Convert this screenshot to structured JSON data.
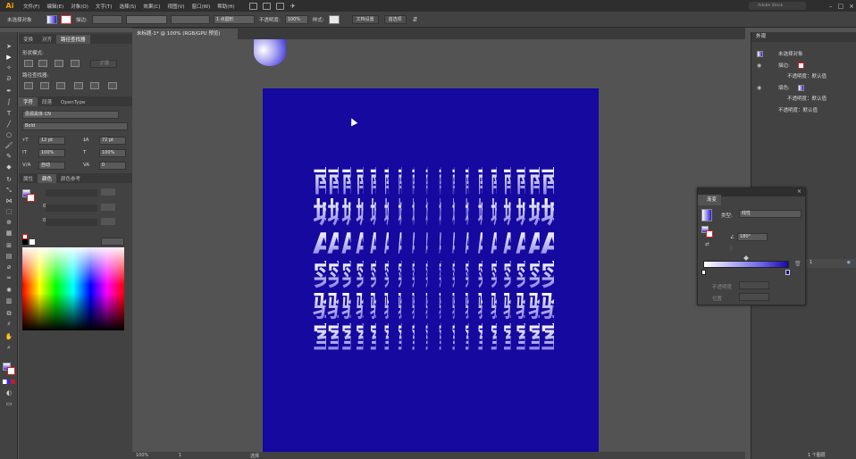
{
  "menubar": {
    "logo": "Ai",
    "items": [
      "文件(F)",
      "编辑(E)",
      "对象(O)",
      "文字(T)",
      "选择(S)",
      "效果(C)",
      "视图(V)",
      "窗口(W)",
      "帮助(H)"
    ],
    "search_label": "Adobe Stock"
  },
  "controlbar": {
    "selection_state": "未选择对象",
    "stroke_label": "描边:",
    "stroke_weight_label": "1 点圆形",
    "opacity_label": "不透明度:",
    "opacity_value": "100%",
    "style_label": "样式:",
    "doc_setup_button": "文档设置",
    "preferences_button": "首选项"
  },
  "left_panel": {
    "top_tabs": [
      "变换",
      "对齐",
      "路径查找器"
    ],
    "shape_modes_label": "形状模式:",
    "expand_button": "扩展",
    "pathfinders_label": "路径查找器:",
    "char_tabs": [
      "字符",
      "段落",
      "OpenType"
    ],
    "font_family": "思源黑体 CN",
    "font_style": "Bold",
    "font_size": "12 pt",
    "leading": "72 pt",
    "vscale": "100%",
    "hscale": "100%",
    "kerning": "自动",
    "tracking": "0",
    "color_tabs": [
      "属性",
      "颜色",
      "颜色参考"
    ],
    "field_zero_1": "0",
    "field_zero_2": "0"
  },
  "document": {
    "tab_title": "未标题-1* @ 100% (RGB/GPU 预览)",
    "artwork_rows": [
      [
        "南",
        "南",
        "南",
        "南",
        "南",
        "南",
        "南",
        "南",
        "南",
        "南",
        "南",
        "南",
        "南",
        "南",
        "南",
        "南",
        "南",
        "南"
      ],
      [
        "城",
        "城",
        "城",
        "城",
        "城",
        "城",
        "城",
        "城",
        "城",
        "城",
        "城",
        "城",
        "城",
        "城",
        "城",
        "城",
        "城",
        "城"
      ],
      [
        "A",
        "A",
        "A",
        "A",
        "A",
        "A",
        "A",
        "A",
        "A",
        "A",
        "A",
        "A",
        "A",
        "A",
        "A",
        "A",
        "A",
        "A"
      ],
      [
        "实",
        "实",
        "实",
        "实",
        "实",
        "实",
        "实",
        "实",
        "实",
        "实",
        "实",
        "实",
        "实",
        "实",
        "实",
        "实",
        "实",
        "实"
      ],
      [
        "验",
        "验",
        "验",
        "验",
        "验",
        "验",
        "验",
        "验",
        "验",
        "验",
        "验",
        "验",
        "验",
        "验",
        "验",
        "验",
        "验",
        "验"
      ],
      [
        "室",
        "室",
        "室",
        "室",
        "室",
        "室",
        "室",
        "室",
        "室",
        "室",
        "室",
        "室",
        "室",
        "室",
        "室",
        "室",
        "室",
        "室"
      ]
    ],
    "artboard_color": "#15099f"
  },
  "statusbar": {
    "zoom": "100%",
    "page": "1",
    "tool_name": "选择"
  },
  "appearance_panel": {
    "title": "外观",
    "object_label": "未选择对象",
    "stroke_label": "描边:",
    "stroke_opacity": "不透明度：默认值",
    "fill_label": "填色:",
    "fill_opacity": "不透明度：默认值",
    "object_opacity": "不透明度：默认值"
  },
  "gradient_panel": {
    "title": "渐变",
    "type_label": "类型:",
    "type_value": "线性",
    "angle_value": "180°",
    "opacity_label": "不透明度",
    "location_label": "位置"
  },
  "layers_panel": {
    "layer_count": "1 个图层",
    "row_label": "1"
  }
}
